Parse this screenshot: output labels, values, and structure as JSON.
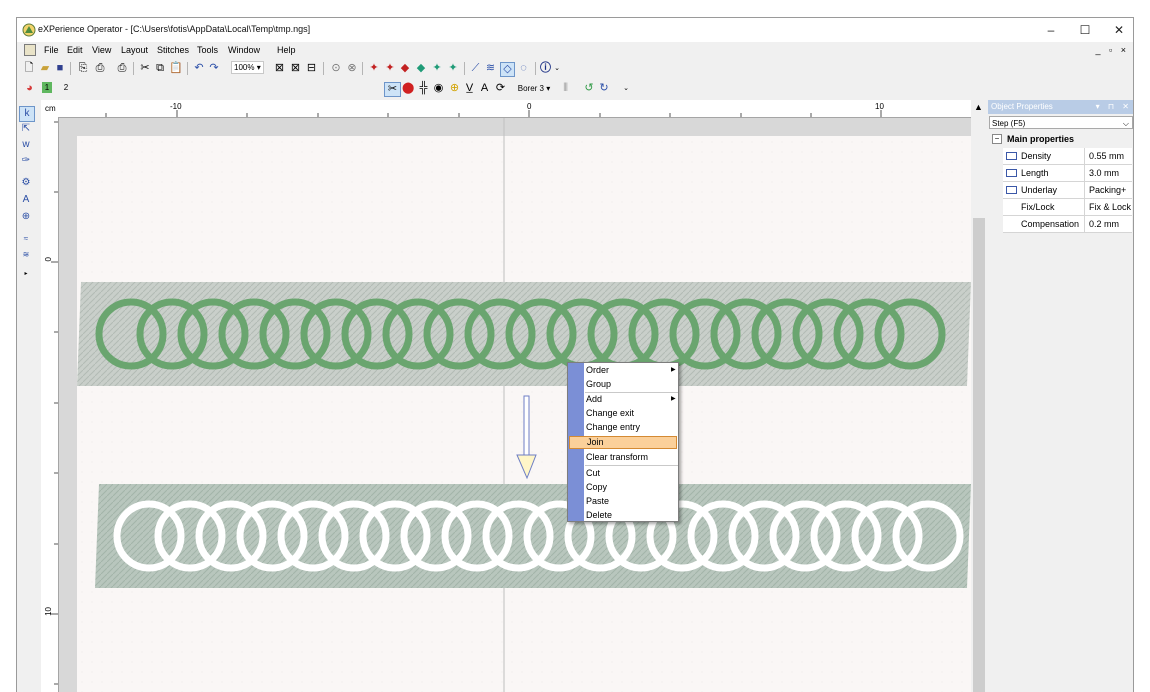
{
  "window": {
    "title": "eXPerience Operator - [C:\\Users\\fotis\\AppData\\Local\\Temp\\tmp.ngs]",
    "controls": [
      "–",
      "☐",
      "✕"
    ]
  },
  "menu": {
    "items": [
      "File",
      "Edit",
      "View",
      "Layout",
      "Stitches",
      "Tools",
      "Window",
      "Help"
    ],
    "mdi_controls": "_ ▫ ×"
  },
  "toolbar": {
    "zoom": "100%",
    "chips": [
      "1",
      "2"
    ],
    "tool_label": "Borer 3"
  },
  "ruler": {
    "unit": "cm",
    "h_labels": [
      "-10",
      "0",
      "10"
    ],
    "v_labels": [
      "0",
      "10"
    ]
  },
  "object_properties": {
    "title": "Object Properties",
    "title_buttons": "▾ ⊓ ✕",
    "dropdown": "Step (F5)",
    "group": "Main properties",
    "rows": [
      {
        "name": "Density",
        "value": "0.55 mm",
        "icon": "density-icon"
      },
      {
        "name": "Length",
        "value": "3.0 mm",
        "icon": "length-icon"
      },
      {
        "name": "Underlay",
        "value": "Packing+",
        "icon": "underlay-icon"
      },
      {
        "name": "Fix/Lock",
        "value": "Fix & Lock",
        "icon": ""
      },
      {
        "name": "Compensation",
        "value": "0.2 mm",
        "icon": ""
      }
    ]
  },
  "context_menu": {
    "items": [
      "Order",
      "Group",
      "Add",
      "Change exit",
      "Change entry",
      "Join",
      "Clear transform",
      "Cut",
      "Copy",
      "Paste",
      "Delete"
    ],
    "highlighted": "Join"
  },
  "colors": {
    "accent_highlight": "#fbd09a",
    "green_thread": "#6aa56f",
    "panel_title": "#b9cce6"
  }
}
